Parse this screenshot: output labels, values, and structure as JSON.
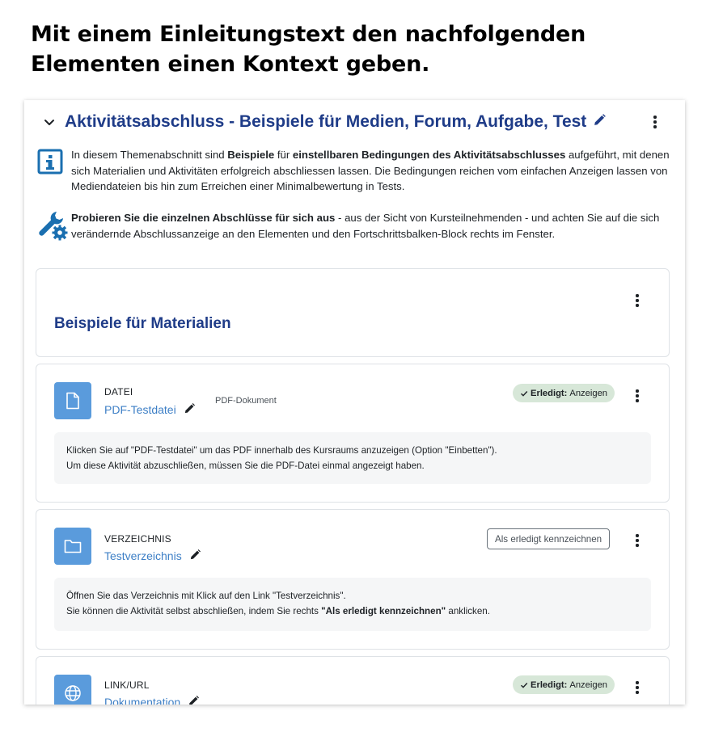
{
  "heading": {
    "line1": "Mit einem Einleitungstext den nachfolgenden",
    "line2": "Elementen einen Kontext geben."
  },
  "section": {
    "title": "Aktivitätsabschluss - Beispiele für Medien, Forum, Aufgabe, Test",
    "intro1": {
      "icon": "info-icon",
      "p1": "In diesem Themenabschnitt sind ",
      "b1": "Beispiele",
      "p2": " für ",
      "b2": "einstellbaren Bedingungen des Aktivitätsabschlusses",
      "p3": " aufgeführt, mit denen sich Materialien und Aktivitäten erfolgreich abschliessen lassen. Die Bedingungen reichen vom einfachen Anzeigen lassen von Mediendateien bis hin zum Erreichen einer Minimalbewertung in Tests."
    },
    "intro2": {
      "icon": "wrench-gear-icon",
      "b1": "Probieren Sie die einzelnen Abschlüsse für sich aus",
      "p1": " - aus der Sicht von Kursteilnehmenden - und achten Sie auf die sich verändernde Abschlussanzeige an den Elementen und den Fortschrittsbalken-Block rechts im Fenster."
    }
  },
  "subsection": {
    "title": "Beispiele für Materialien"
  },
  "activities": [
    {
      "type": "DATEI",
      "name": "PDF-Testdatei",
      "meta": "PDF-Dokument",
      "icon": "file-icon",
      "status_label": "Erledigt:",
      "status_value": "Anzeigen",
      "desc_line1": "Klicken Sie auf \"PDF-Testdatei\" um das PDF innerhalb des Kursraums anzuzeigen (Option \"Einbetten\").",
      "desc_line2": "Um diese Aktivität abzuschließen, müssen Sie die PDF-Datei einmal angezeigt haben."
    },
    {
      "type": "VERZEICHNIS",
      "name": "Testverzeichnis",
      "icon": "folder-icon",
      "button_label": "Als erledigt kennzeichnen",
      "desc_line1": "Öffnen Sie das Verzeichnis mit Klick auf den Link \"Testverzeichnis\".",
      "desc_line2a": "Sie können die Aktivität selbst abschließen, indem Sie rechts ",
      "desc_line2b": "\"Als erledigt kennzeichnen\"",
      "desc_line2c": " anklicken."
    },
    {
      "type": "LINK/URL",
      "name": "Dokumentation",
      "icon": "globe-icon",
      "status_label": "Erledigt:",
      "status_value": "Anzeigen"
    }
  ],
  "colors": {
    "section_title": "#1f3c88",
    "activity_link": "#3d7fc6",
    "activity_icon_bg": "#5a9bdc",
    "done_badge_bg": "#d7e7d8"
  }
}
